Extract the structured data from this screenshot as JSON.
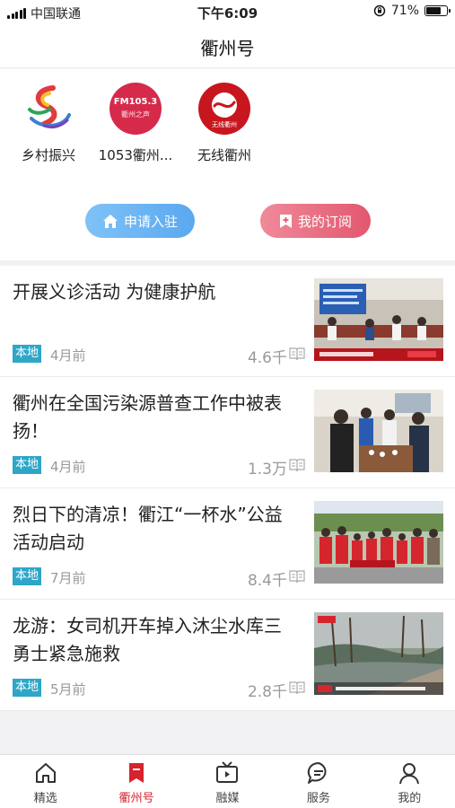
{
  "status_bar": {
    "carrier": "中国联通",
    "time": "下午6:09",
    "battery": "71%",
    "battery_level": 0.71
  },
  "header": {
    "title": "衢州号"
  },
  "accounts": [
    {
      "name": "乡村振兴"
    },
    {
      "name": "1053衢州...",
      "logo_text": "FM105.3",
      "logo_sub": "衢州之声"
    },
    {
      "name": "无线衢州",
      "logo_text": "无线衢州"
    }
  ],
  "actions": {
    "apply_label": "申请入驻",
    "subscribe_label": "我的订阅"
  },
  "news": [
    {
      "title": "开展义诊活动 为健康护航",
      "tag": "本地",
      "time": "4月前",
      "views": "4.6千"
    },
    {
      "title": "衢州在全国污染源普查工作中被表扬！",
      "tag": "本地",
      "time": "4月前",
      "views": "1.3万"
    },
    {
      "title": "烈日下的清凉！衢江“一杯水”公益活动启动",
      "tag": "本地",
      "time": "7月前",
      "views": "8.4千"
    },
    {
      "title": "龙游：女司机开车掉入沐尘水库三勇士紧急施救",
      "tag": "本地",
      "time": "5月前",
      "views": "2.8千"
    }
  ],
  "tabs": [
    {
      "label": "精选"
    },
    {
      "label": "衢州号"
    },
    {
      "label": "融媒"
    },
    {
      "label": "服务"
    },
    {
      "label": "我的"
    }
  ],
  "colors": {
    "accent": "#d7232d",
    "tag": "#2fa6c8",
    "apply": "#5aa8f0",
    "subscribe": "#e2576e"
  }
}
